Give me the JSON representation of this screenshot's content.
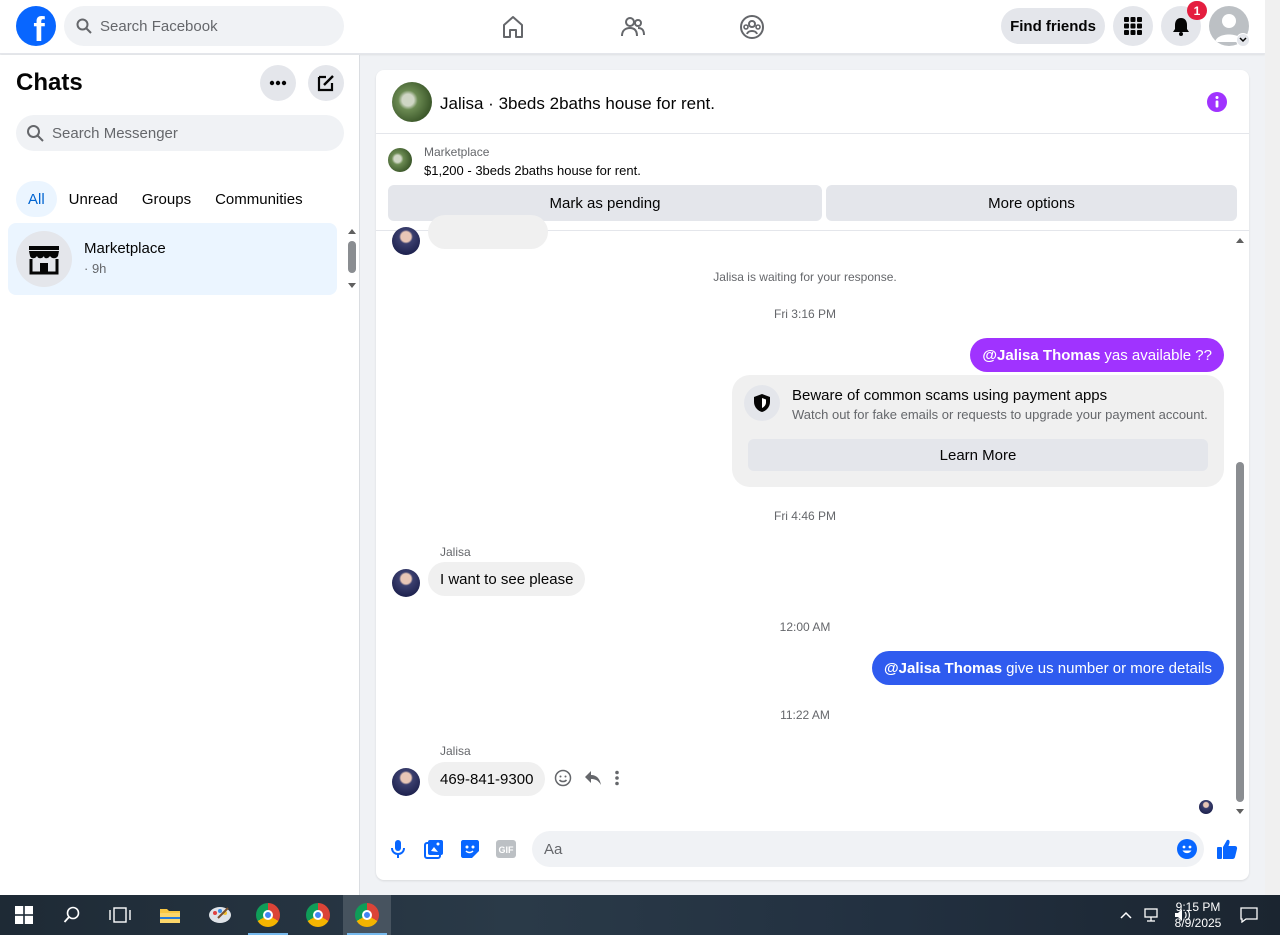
{
  "topbar": {
    "logo": "f",
    "search_placeholder": "Search Facebook",
    "find_friends": "Find friends",
    "notification_count": "1",
    "icons": [
      "home-icon",
      "friends-icon",
      "groups-icon",
      "menu-grid-icon",
      "bell-icon"
    ]
  },
  "sidebar": {
    "title": "Chats",
    "search_placeholder": "Search Messenger",
    "filters": [
      "All",
      "Unread",
      "Groups",
      "Communities"
    ],
    "active_filter": "All",
    "chats": [
      {
        "name": "Marketplace",
        "time": "· 9h",
        "icon": "store-icon"
      }
    ]
  },
  "conversation": {
    "title": "Jalisa · 3beds 2baths house for rent.",
    "marketplace": {
      "label": "Marketplace",
      "listing": "$1,200 - 3beds 2baths house for rent.",
      "pending_button": "Mark as pending",
      "options_button": "More options"
    },
    "waiting_note": "Jalisa is waiting for your response.",
    "timestamps": [
      "Fri 3:16 PM",
      "Fri 4:46 PM",
      "12:00 AM",
      "11:22 AM"
    ],
    "messages": [
      {
        "from": "me",
        "mention": "@Jalisa Thomas",
        "text": " yas available ??",
        "color": "#a033ff"
      },
      {
        "from": "Jalisa",
        "text": "I want to see please"
      },
      {
        "from": "me",
        "mention": "@Jalisa Thomas",
        "text": "give us number or more details",
        "color": "#2f5bef"
      },
      {
        "from": "Jalisa",
        "text": "469-841-9300"
      }
    ],
    "scam_warning": {
      "title": "Beware of common scams using payment apps",
      "description": "Watch out for fake emails or requests to upgrade your payment account.",
      "button": "Learn More"
    },
    "composer_placeholder": "Aa"
  },
  "colors": {
    "brand": "#0866ff",
    "accent_purple": "#a033ff",
    "accent_blue": "#2f5bef",
    "badge_red": "#e41e3f"
  },
  "taskbar": {
    "time": "9:15 PM",
    "date": "8/9/2025"
  }
}
